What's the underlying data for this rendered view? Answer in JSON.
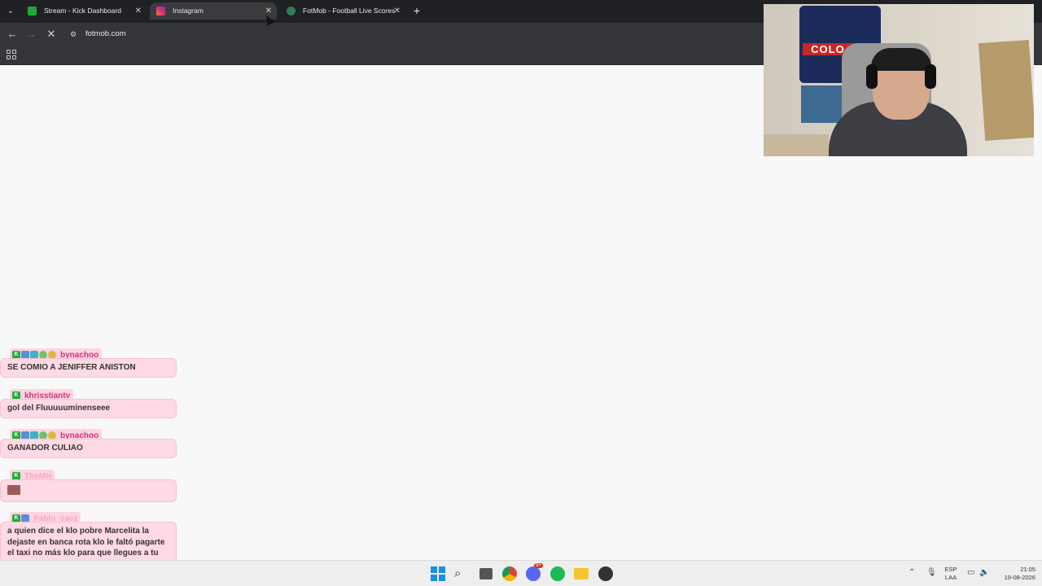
{
  "browser": {
    "tabs": [
      {
        "label": "Stream - Kick Dashboard",
        "favicon": "kick-icon",
        "color": "#53fc18",
        "active": false
      },
      {
        "label": "Instagram",
        "favicon": "instagram-icon",
        "color": "#e1306c",
        "active": true
      },
      {
        "label": "FotMob - Football Live Scores",
        "favicon": "fotmob-icon",
        "color": "#00985f",
        "active": false
      }
    ],
    "address": "fotmob.com"
  },
  "chat": {
    "messages": [
      {
        "user": "bynachoo",
        "text": "SE COMIO A JENIFFER ANISTON"
      },
      {
        "user": "khrisstiantv",
        "text": "gol del Fluuuuuminenseee"
      },
      {
        "user": "bynachoo",
        "text": "GANADOR CULIAO"
      },
      {
        "user": "TheMH",
        "text": ""
      },
      {
        "user": "Pablo_saez",
        "text": "a quien dice el klo pobre Marcelita la dejaste en banca rota klo le faltó pagarte el taxi no más klo para que llegues a tu casa"
      }
    ]
  },
  "webcam": {
    "poster_text": "COLO CO"
  },
  "taskbar": {
    "language": "ESP",
    "layout": "LAA",
    "time": "21:05",
    "date": "19-08-2026",
    "discord_badge": "9+"
  }
}
